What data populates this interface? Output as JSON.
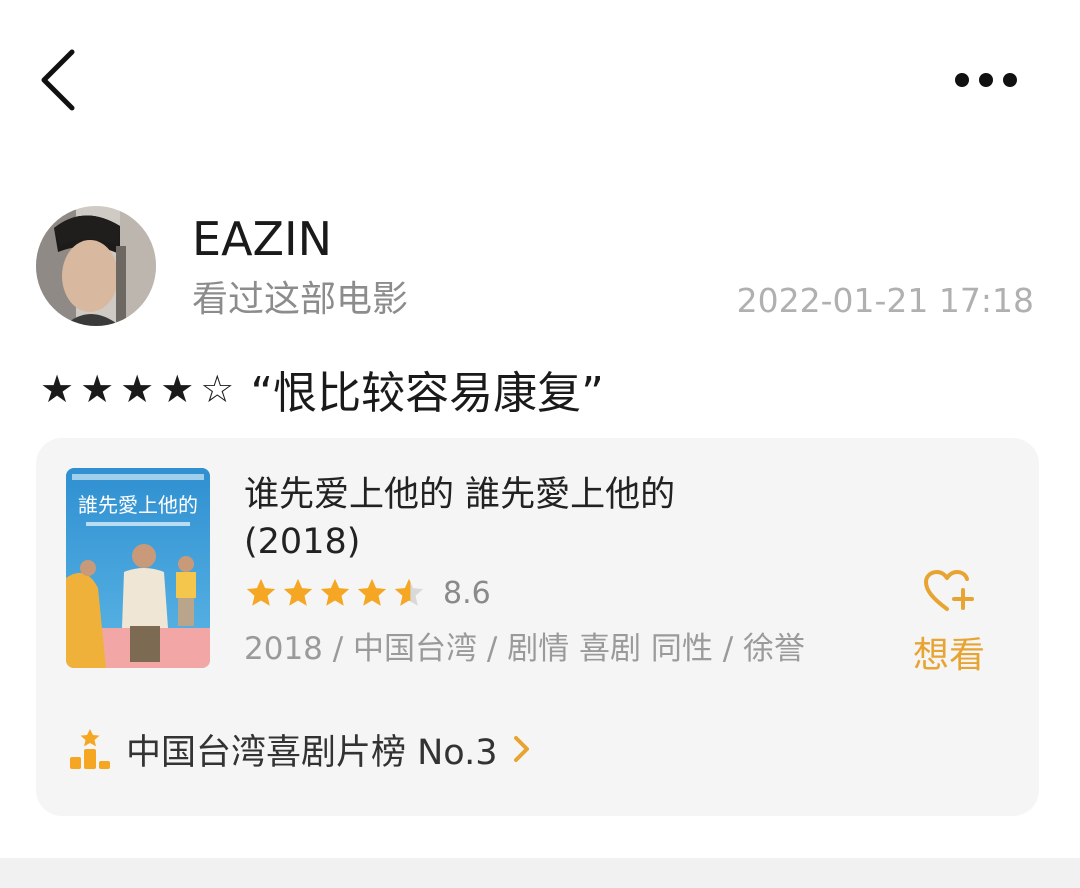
{
  "header": {
    "back_icon": "chevron-left-icon",
    "more_icon": "more-horizontal-icon"
  },
  "post": {
    "username": "EAZIN",
    "action": "看过这部电影",
    "timestamp": "2022-01-21 17:18",
    "user_rating_stars": "★★★★☆",
    "user_rating": 4,
    "review_title": "“恨比较容易康复”"
  },
  "movie": {
    "title": "谁先爱上他的 誰先愛上他的 (2018)",
    "rating_score": "8.6",
    "rating_stars_fraction": 0.86,
    "meta": "2018 / 中国台湾 / 剧情 喜剧 同性 / 徐誉",
    "want_label": "想看",
    "want_icon": "heart-plus-icon",
    "poster_text": "誰先愛上他的",
    "rank_text": "中国台湾喜剧片榜 No.3",
    "rank_icon": "ranking-podium-icon"
  },
  "colors": {
    "accent": "#e8a432",
    "star_filled": "#f5a623",
    "star_empty": "#d9d9d9",
    "card_bg": "#f5f5f5"
  }
}
